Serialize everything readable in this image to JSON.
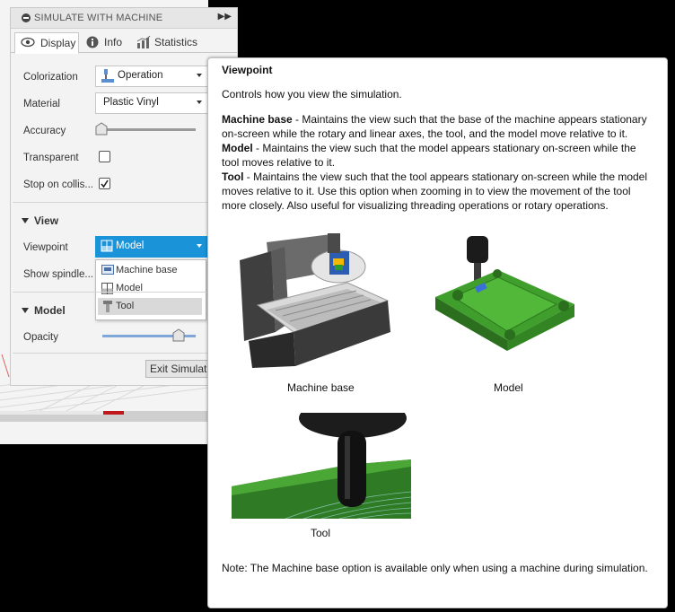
{
  "panel": {
    "title": "SIMULATE WITH MACHINE",
    "tabs": [
      {
        "label": "Display",
        "icon": "eye-icon",
        "active": true
      },
      {
        "label": "Info",
        "icon": "info-icon",
        "active": false
      },
      {
        "label": "Statistics",
        "icon": "statistics-icon",
        "active": false
      }
    ],
    "colorization": {
      "label": "Colorization",
      "value": "Operation"
    },
    "material": {
      "label": "Material",
      "value": "Plastic Vinyl"
    },
    "accuracy": {
      "label": "Accuracy",
      "level": 0.0
    },
    "transparent": {
      "label": "Transparent",
      "checked": false
    },
    "stop_on_collision": {
      "label": "Stop on collis...",
      "checked": true
    },
    "view_section": "View",
    "viewpoint": {
      "label": "Viewpoint",
      "value": "Model",
      "options": [
        "Machine base",
        "Model",
        "Tool"
      ],
      "highlighted": "Tool"
    },
    "show_spindle": {
      "label": "Show spindle..."
    },
    "model_section": "Model",
    "opacity": {
      "label": "Opacity",
      "level": 0.85
    },
    "exit_button": "Exit Simulati"
  },
  "tooltip": {
    "title": "Viewpoint",
    "intro": "Controls how you view the simulation.",
    "items": [
      {
        "term": "Machine base",
        "text": " - Maintains the view such that the base of the machine appears stationary on-screen while the rotary and linear axes, the tool, and the model move relative to it."
      },
      {
        "term": "Model",
        "text": " - Maintains the view such that the model appears stationary on-screen while the tool moves relative to it."
      },
      {
        "term": "Tool",
        "text": " - Maintains the view such that the tool appears stationary on-screen while the model moves relative to it. Use this option when zooming in to view the movement of the tool more closely. Also useful for visualizing threading operations or rotary operations."
      }
    ],
    "captions": {
      "machine_base": "Machine base",
      "model": "Model",
      "tool": "Tool"
    },
    "note": "Note: The Machine base option is available only when using a machine during simulation."
  },
  "colors": {
    "accent": "#1a93d9",
    "model_green": "#3f9e2c",
    "slider_fill": "#7fa7d8",
    "timeline_red": "#c0171c"
  }
}
